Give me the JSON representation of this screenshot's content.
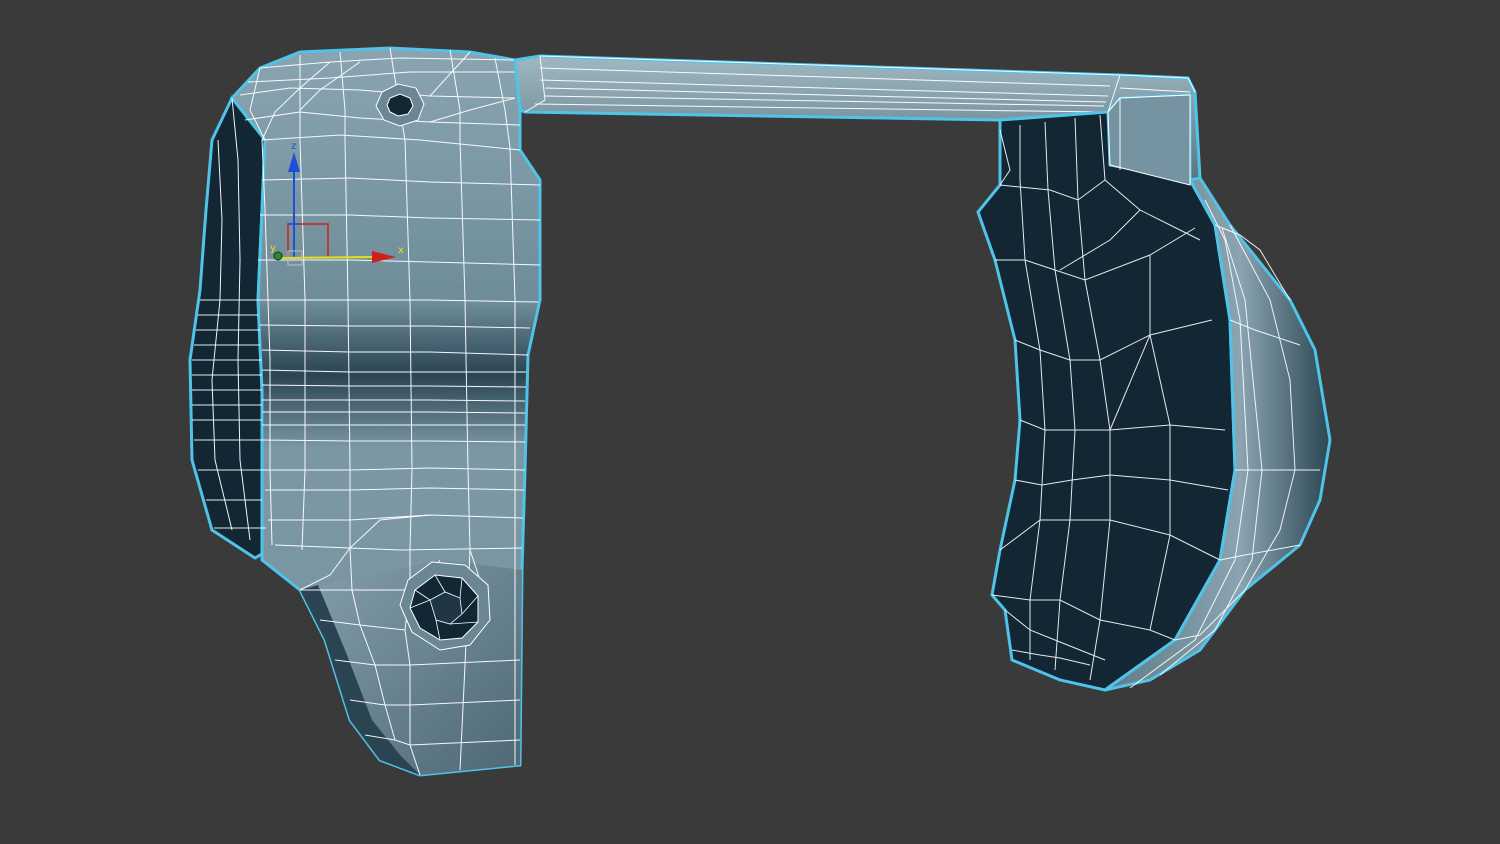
{
  "viewport": {
    "background": "#3a3a3a",
    "selection_outline": "#4fc3e8",
    "wire_color": "#ffffff",
    "shade_light": "#7e9aa6",
    "shade_dark": "#122633"
  },
  "gizmo": {
    "axis_x": {
      "label": "x",
      "color": "#d0201a"
    },
    "axis_y": {
      "label": "y",
      "color": "#2d8a2a"
    },
    "axis_z": {
      "label": "z",
      "color": "#1f4fd8"
    },
    "icons": [
      "transform-gizmo-icon"
    ]
  }
}
